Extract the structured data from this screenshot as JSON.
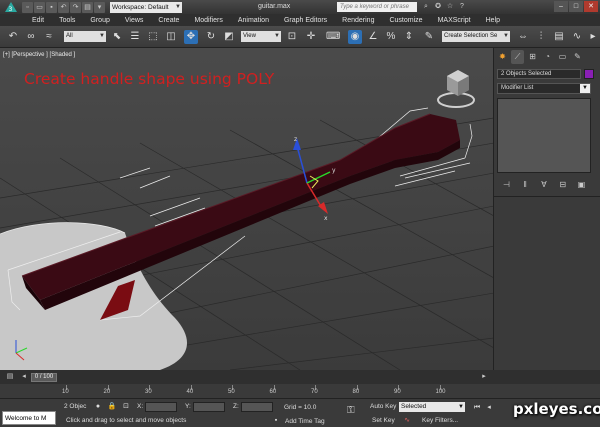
{
  "titlebar": {
    "workspace": "Workspace: Default",
    "document_title": "guitar.max",
    "search_placeholder": "Type a keyword or phrase"
  },
  "menu": [
    "Edit",
    "Tools",
    "Group",
    "Views",
    "Create",
    "Modifiers",
    "Animation",
    "Graph Editors",
    "Rendering",
    "Customize",
    "MAXScript",
    "Help"
  ],
  "toolbar": {
    "filter_value": "All",
    "coord_system": "View",
    "named_selection": "Create Selection Se"
  },
  "viewport": {
    "label": "[+] [Perspective ] [Shaded ]",
    "caption": "Create handle shape using POLY",
    "gizmo_axes": [
      "x",
      "y",
      "z"
    ]
  },
  "command_panel": {
    "selection_name": "2 Objects Selected",
    "object_color": "#8a1fb4",
    "modifier_list": "Modifier List"
  },
  "timeslider": {
    "position": "0 / 100"
  },
  "trackbar": {
    "ticks": [
      "10",
      "20",
      "30",
      "40",
      "50",
      "60",
      "70",
      "80",
      "90",
      "100"
    ]
  },
  "status": {
    "maxscript_listener": "Welcome to M",
    "selection_count": "2 Objec",
    "x_label": "X:",
    "y_label": "Y:",
    "z_label": "Z:",
    "grid": "Grid = 10.0",
    "prompt": "Click and drag to select and move objects",
    "add_time_tag": "Add Time Tag",
    "auto_key": "Auto Key",
    "set_key": "Set Key",
    "key_mode": "Selected",
    "key_filters": "Key Filters..."
  },
  "watermark": "pxleyes.com",
  "colors": {
    "handle": "#3a0a14",
    "body": "#c8c8c8",
    "caption": "#d02020"
  }
}
